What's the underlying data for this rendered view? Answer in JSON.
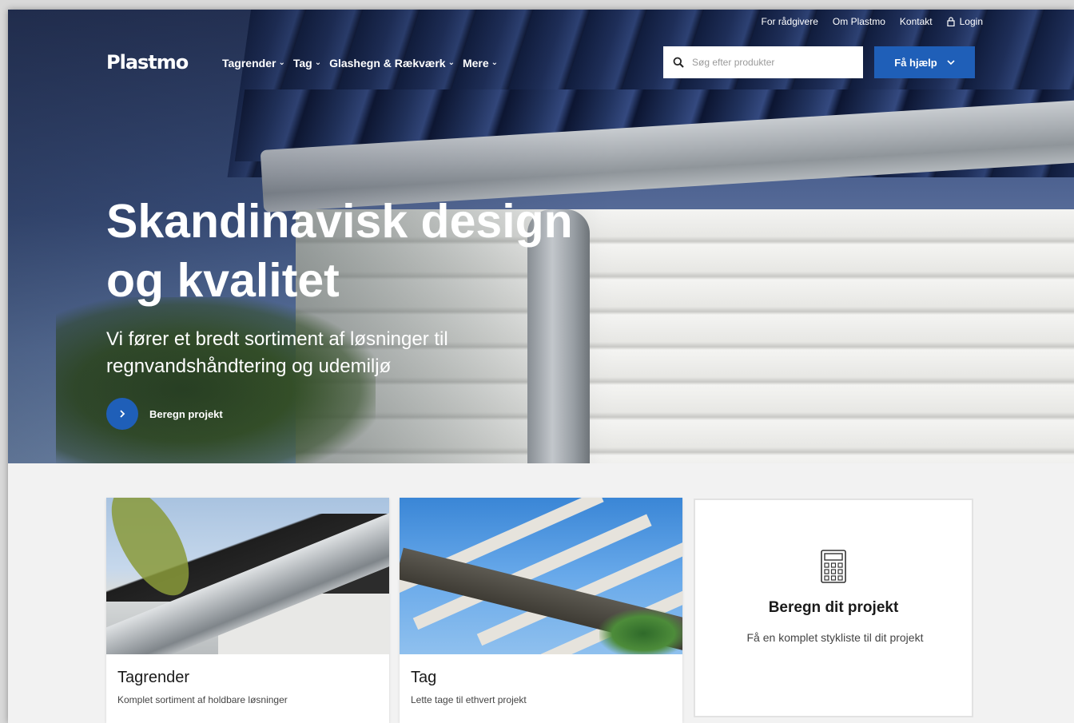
{
  "header": {
    "logo": "Plastmo",
    "utility_links": [
      "For rådgivere",
      "Om Plastmo",
      "Kontakt"
    ],
    "login_label": "Login",
    "nav": [
      {
        "label": "Tagrender"
      },
      {
        "label": "Tag"
      },
      {
        "label": "Glashegn & Rækværk"
      },
      {
        "label": "Mere"
      }
    ],
    "search_placeholder": "Søg efter produkter",
    "help_button": "Få hjælp"
  },
  "hero": {
    "title_line1": "Skandinavisk design",
    "title_line2": "og kvalitet",
    "subtitle": "Vi fører et bredt sortiment af løsninger til regnvandshåndtering og udemiljø",
    "cta_label": "Beregn projekt"
  },
  "cards": [
    {
      "title": "Tagrender",
      "description": "Komplet sortiment af holdbare løsninger"
    },
    {
      "title": "Tag",
      "description": "Lette tage til ethvert projekt"
    }
  ],
  "calc_card": {
    "title": "Beregn dit projekt",
    "description": "Få en komplet stykliste til dit projekt",
    "icon": "calculator-icon"
  },
  "colors": {
    "accent": "#1f5fb8",
    "page_bg": "#f2f2f2",
    "card_bg": "#ffffff"
  }
}
